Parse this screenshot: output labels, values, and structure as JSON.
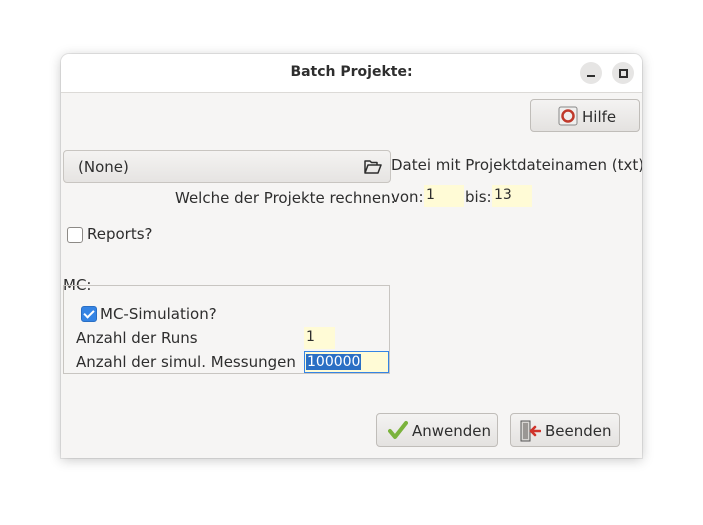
{
  "window": {
    "title": "Batch Projekte:"
  },
  "help_button": {
    "label": "Hilfe",
    "icon": "lifebuoy-icon"
  },
  "file": {
    "selected": "(None)",
    "description": "Datei mit Projektdateinamen (txt)",
    "icon": "folder-open-icon"
  },
  "range": {
    "question": "Welche der Projekte rechnen:",
    "from_label": "von:",
    "from_value": "1",
    "to_label": "bis:",
    "to_value": "13"
  },
  "reports": {
    "label": "Reports?",
    "checked": false
  },
  "mc": {
    "group_label": "MC:",
    "simulation_label": "MC-Simulation?",
    "simulation_checked": true,
    "runs_label": "Anzahl der Runs",
    "runs_value": "1",
    "measurements_label": "Anzahl der simul. Messungen",
    "measurements_value": "100000"
  },
  "footer": {
    "apply_label": "Anwenden",
    "apply_icon": "checkmark-icon",
    "quit_label": "Beenden",
    "quit_icon": "exit-door-icon"
  },
  "colors": {
    "field_background": "#fffbd6",
    "accent": "#3584e4",
    "apply_check": "#7bb33c",
    "quit_arrow": "#d0342c"
  }
}
